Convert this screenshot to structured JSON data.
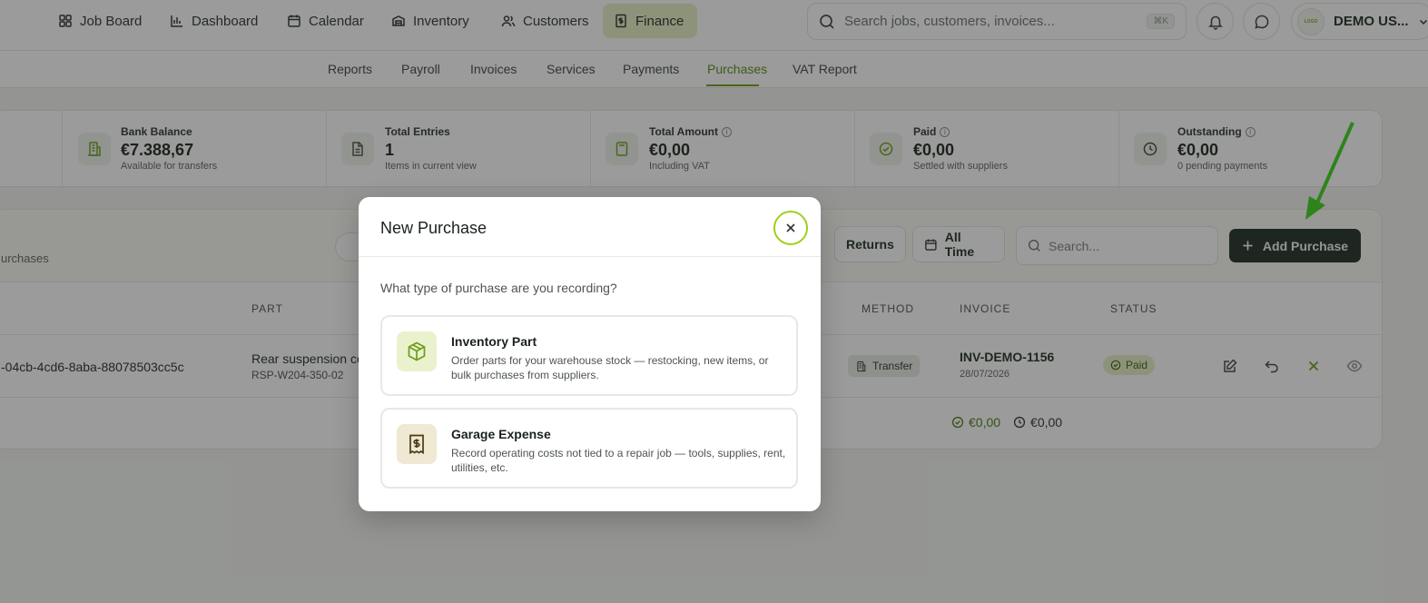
{
  "nav": {
    "items": [
      {
        "label": "Job Board",
        "icon": "grid-icon"
      },
      {
        "label": "Dashboard",
        "icon": "bar-chart-icon"
      },
      {
        "label": "Calendar",
        "icon": "calendar-icon"
      },
      {
        "label": "Inventory",
        "icon": "inventory-icon"
      },
      {
        "label": "Customers",
        "icon": "users-icon"
      },
      {
        "label": "Finance",
        "icon": "finance-icon",
        "active": true
      }
    ],
    "search_placeholder": "Search jobs, customers, invoices...",
    "shortcut": "⌘K",
    "user_name": "DEMO US...",
    "avatar_text": "LOGO"
  },
  "subnav": {
    "tabs": [
      "Reports",
      "Payroll",
      "Invoices",
      "Services",
      "Payments",
      "Purchases",
      "VAT Report"
    ],
    "active": "Purchases"
  },
  "stats": [
    {
      "label": "Bank Balance",
      "value": "€7.388,67",
      "sub": "Available for transfers"
    },
    {
      "label": "Total Entries",
      "value": "1",
      "sub": "Items in current view"
    },
    {
      "label": "Total Amount",
      "value": "€0,00",
      "sub": "Including VAT"
    },
    {
      "label": "Paid",
      "value": "€0,00",
      "sub": "Settled with suppliers"
    },
    {
      "label": "Outstanding",
      "value": "€0,00",
      "sub": "0 pending payments"
    }
  ],
  "table": {
    "subtitle": "urchases",
    "returns_label": "Returns",
    "period_label": "All Time",
    "search_placeholder": "Search...",
    "add_label": "Add Purchase",
    "headers": {
      "part": "PART",
      "method": "METHOD",
      "invoice": "INVOICE",
      "status": "STATUS"
    },
    "rows": [
      {
        "id": "-04cb-4cd6-8aba-88078503cc5c",
        "part_name": "Rear suspension co",
        "part_code": "RSP-W204-350-02",
        "method": "Transfer",
        "invoice": "INV-DEMO-1156",
        "date": "28/07/2026",
        "status": "Paid"
      }
    ],
    "totals": {
      "paid": "€0,00",
      "outstanding": "€0,00"
    }
  },
  "modal": {
    "title": "New Purchase",
    "question": "What type of purchase are you recording?",
    "options": [
      {
        "title": "Inventory Part",
        "desc": "Order parts for your warehouse stock — restocking, new items, or bulk purchases from suppliers.",
        "icon": "box-icon"
      },
      {
        "title": "Garage Expense",
        "desc": "Record operating costs not tied to a repair job — tools, supplies, rent, utilities, etc.",
        "icon": "receipt-icon"
      }
    ]
  },
  "colors": {
    "accent": "#6e9d1c",
    "dark_button": "#1d2a22",
    "arrow": "#39d617"
  }
}
